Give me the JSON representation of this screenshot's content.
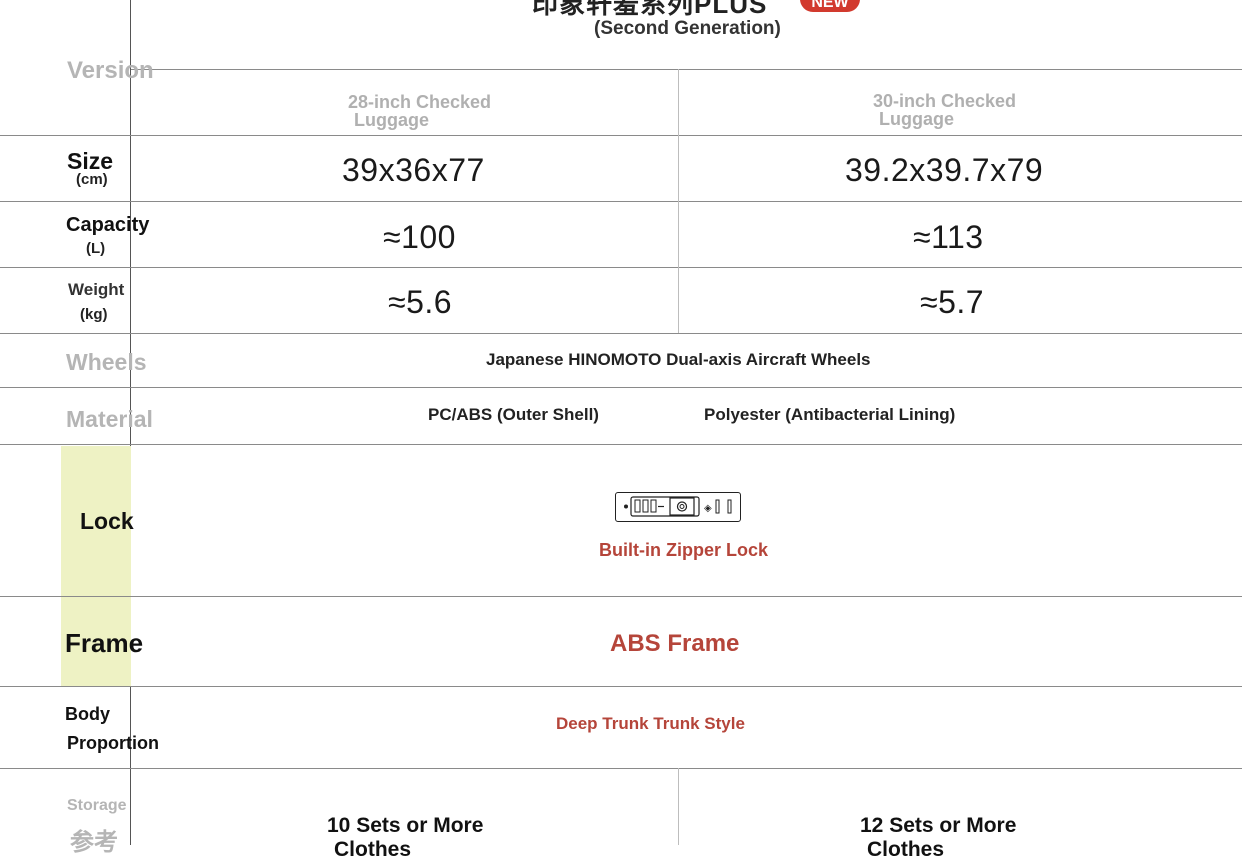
{
  "header": {
    "title_cut": "印象轩羞系列PLUS",
    "badge": "NEW",
    "subtitle": "(Second Generation)"
  },
  "columns": {
    "col1": "28-inch Checked\nLuggage",
    "col1_line1": "28-inch Checked",
    "col1_line2": "Luggage",
    "col2_line1": "30-inch Checked",
    "col2_line2": "Luggage"
  },
  "rows": {
    "version": "Version",
    "size_label": "Size",
    "size_unit": "(cm)",
    "size_v1": "39x36x77",
    "size_v2": "39.2x39.7x79",
    "capacity_label": "Capacity",
    "capacity_unit": "(L)",
    "capacity_v1": "≈100",
    "capacity_v2": "≈113",
    "weight_label": "Weight",
    "weight_unit": "(kg)",
    "weight_v1": "≈5.6",
    "weight_v2": "≈5.7",
    "wheels_label": "Wheels",
    "wheels_value": "Japanese HINOMOTO Dual-axis Aircraft Wheels",
    "material_label": "Material",
    "material_v1": "PC/ABS (Outer Shell)",
    "material_v2": "Polyester (Antibacterial Lining)",
    "lock_label": "Lock",
    "lock_value": "Built-in Zipper Lock",
    "frame_label": "Frame",
    "frame_value": "ABS Frame",
    "body_label_1": "Body",
    "body_label_2": "Proportion",
    "body_value": "Deep Trunk Trunk Style",
    "storage_label": "Storage",
    "storage_ref": "参考",
    "storage_v1_line1": "10 Sets or More",
    "storage_v1_line2": "Clothes",
    "storage_v2_line1": "12 Sets or More",
    "storage_v2_line2": "Clothes"
  },
  "colors": {
    "accent_red": "#b5453a",
    "badge_red": "#d23a2e",
    "lock_col_bg": "#eef2c4",
    "grey_label": "#b5b5b5"
  }
}
